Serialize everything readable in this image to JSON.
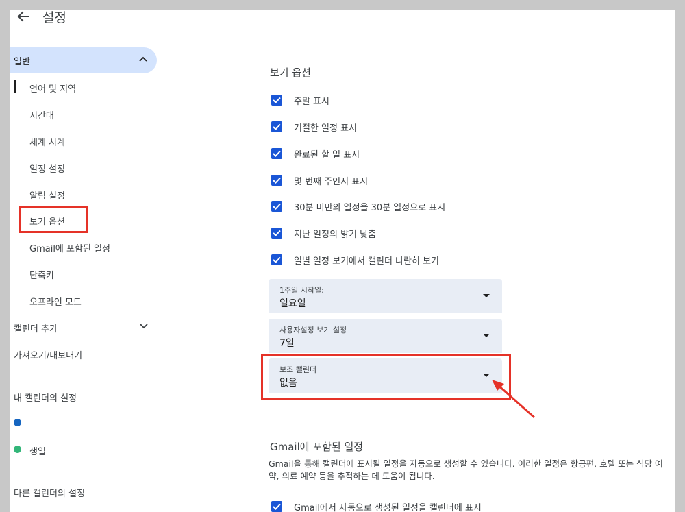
{
  "header": {
    "title": "설정"
  },
  "sidebar": {
    "general": {
      "label": "일반"
    },
    "items": [
      {
        "label": "언어 및 지역"
      },
      {
        "label": "시간대"
      },
      {
        "label": "세계 시계"
      },
      {
        "label": "일정 설정"
      },
      {
        "label": "알림 설정"
      },
      {
        "label": "보기 옵션"
      },
      {
        "label": "Gmail에 포함된 일정"
      },
      {
        "label": "단축키"
      },
      {
        "label": "오프라인 모드"
      }
    ],
    "add_calendar": {
      "label": "캘린더 추가"
    },
    "import_export": {
      "label": "가져오기/내보내기"
    },
    "my_calendars": {
      "heading": "내 캘린더의 설정",
      "birthday": "생일"
    },
    "other_calendars": {
      "heading": "다른 캘린더의 설정"
    }
  },
  "view_options": {
    "title": "보기 옵션",
    "checkboxes": [
      {
        "label": "주말 표시",
        "checked": true
      },
      {
        "label": "거절한 일정 표시",
        "checked": true
      },
      {
        "label": "완료된 할 일 표시",
        "checked": true
      },
      {
        "label": "몇 번째 주인지 표시",
        "checked": true
      },
      {
        "label": "30분 미만의 일정을 30분 일정으로 표시",
        "checked": true
      },
      {
        "label": "지난 일정의 밝기 낮춤",
        "checked": true
      },
      {
        "label": "일별 일정 보기에서 캘린더 나란히 보기",
        "checked": true
      }
    ],
    "selects": [
      {
        "label": "1주일 시작일:",
        "value": "일요일"
      },
      {
        "label": "사용자설정 보기 설정",
        "value": "7일"
      },
      {
        "label": "보조 캘린더",
        "value": "없음"
      }
    ]
  },
  "gmail_events": {
    "title": "Gmail에 포함된 일정",
    "description": "Gmail을 통해 캘린더에 표시될 일정을 자동으로 생성할 수 있습니다. 이러한 일정은 항공편, 호텔 또는 식당 예약, 의료 예약 등을 추적하는 데 도움이 됩니다.",
    "checkbox": {
      "label": "Gmail에서 자동으로 생성된 일정을 캘린더에 표시",
      "checked": true
    }
  },
  "colors": {
    "accent": "#1a56d6",
    "highlight": "#e53228",
    "selected_bg": "#d3e3fd",
    "calendar_blue": "#1565c0",
    "birthday_green": "#33b679"
  }
}
